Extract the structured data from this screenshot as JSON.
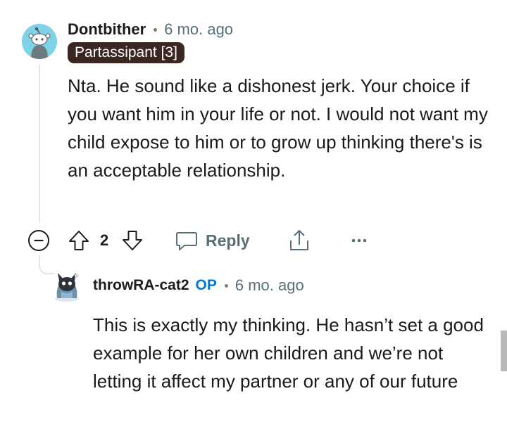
{
  "comment": {
    "username": "Dontbither",
    "time": "6 mo. ago",
    "flair": "Partassipant [3]",
    "body": "Nta. He sound like a dishonest jerk. Your choice if you want him in your life or not. I would not want my child expose to him or to grow up thinking there's is an acceptable relationship.",
    "avatar_color": "#7fd3e8",
    "actions": {
      "vote_count": "2",
      "reply_label": "Reply",
      "icons": [
        "collapse-icon",
        "upvote-icon",
        "downvote-icon",
        "comment-bubble-icon",
        "share-icon",
        "more-icon"
      ]
    }
  },
  "reply": {
    "username": "throwRA-cat2",
    "op_badge": "OP",
    "time": "6 mo. ago",
    "body": "This is exactly my thinking. He hasn’t set a good example for her own children and we’re not letting it affect my partner or any of our future"
  },
  "colors": {
    "flair_bg": "#3a2722",
    "op": "#0079d3",
    "meta": "#576f76",
    "thread_line": "#e3e6e8"
  }
}
